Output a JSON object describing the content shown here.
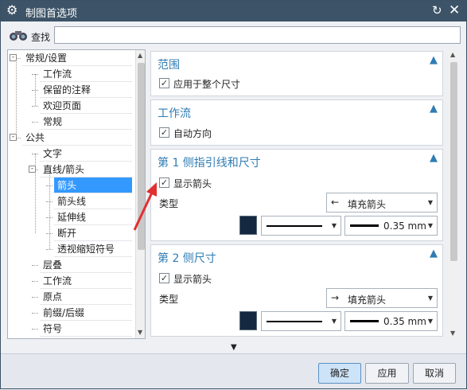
{
  "window": {
    "title": "制图首选项"
  },
  "search": {
    "label": "查找",
    "value": ""
  },
  "tree": {
    "items": [
      {
        "label": "常规/设置",
        "toggle": "-"
      },
      {
        "label": "工作流"
      },
      {
        "label": "保留的注释"
      },
      {
        "label": "欢迎页面"
      },
      {
        "label": "常规"
      },
      {
        "label": "公共",
        "toggle": "-"
      },
      {
        "label": "文字"
      },
      {
        "label": "直线/箭头",
        "toggle": "-"
      },
      {
        "label": "箭头"
      },
      {
        "label": "箭头线"
      },
      {
        "label": "延伸线"
      },
      {
        "label": "断开"
      },
      {
        "label": "透视缩短符号"
      },
      {
        "label": "层叠"
      },
      {
        "label": "工作流"
      },
      {
        "label": "原点"
      },
      {
        "label": "前缀/后缀"
      },
      {
        "label": "符号"
      }
    ],
    "selected": "箭头"
  },
  "sections": {
    "range": {
      "title": "范围",
      "checkbox": "应用于整个尺寸",
      "checked": true
    },
    "workflow": {
      "title": "工作流",
      "checkbox": "自动方向",
      "checked": true
    },
    "side1": {
      "title": "第 1 侧指引线和尺寸",
      "checkbox": "显示箭头",
      "checked": true,
      "type_label": "类型",
      "arrow_type": "填充箭头",
      "line_width": "0.35 mm",
      "color": "#14283f"
    },
    "side2": {
      "title": "第 2 侧尺寸",
      "checkbox": "显示箭头",
      "checked": true,
      "type_label": "类型",
      "arrow_type": "填充箭头",
      "line_width": "0.35 mm",
      "color": "#14283f"
    }
  },
  "buttons": {
    "ok": "确定",
    "apply": "应用",
    "cancel": "取消"
  },
  "icons": {
    "gear": "gear-icon",
    "reset": "reset-icon",
    "close": "close-icon",
    "binoculars": "binoculars-icon",
    "collapse": "chevron-up-icon",
    "expand_more": "chevron-down-icon"
  },
  "colors": {
    "titlebar": "#3d5468",
    "accent": "#2f7cb3",
    "selection": "#3399ff",
    "annotation_arrow": "#e03030"
  }
}
